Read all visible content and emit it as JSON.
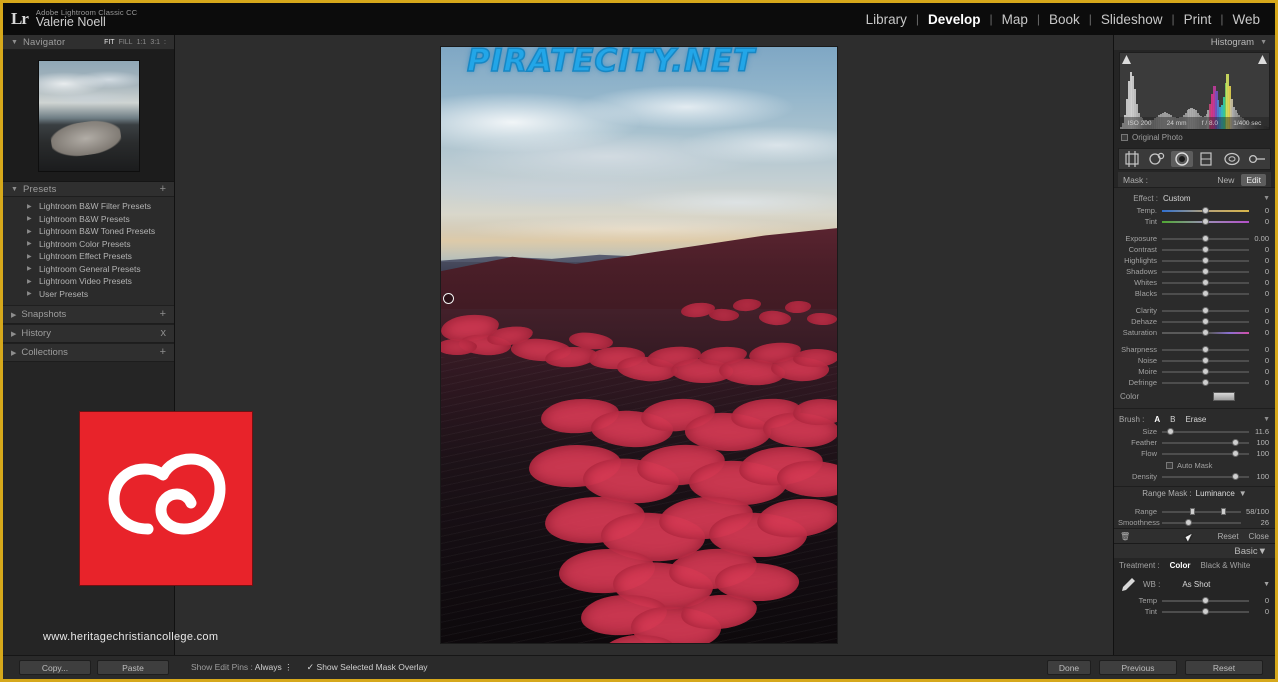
{
  "app": {
    "logo_text": "Lr",
    "product": "Adobe Lightroom Classic CC",
    "user": "Valerie Noell"
  },
  "modules": [
    {
      "label": "Library",
      "active": false
    },
    {
      "label": "Develop",
      "active": true
    },
    {
      "label": "Map",
      "active": false
    },
    {
      "label": "Book",
      "active": false
    },
    {
      "label": "Slideshow",
      "active": false
    },
    {
      "label": "Print",
      "active": false
    },
    {
      "label": "Web",
      "active": false
    }
  ],
  "left_panel": {
    "navigator": {
      "title": "Navigator",
      "zoom_levels": [
        "FIT",
        "FILL",
        "1:1",
        "3:1",
        ":"
      ],
      "selected_zoom": "FIT"
    },
    "presets": {
      "title": "Presets",
      "add_label": "+",
      "items": [
        "Lightroom B&W Filter Presets",
        "Lightroom B&W Presets",
        "Lightroom B&W Toned Presets",
        "Lightroom Color Presets",
        "Lightroom Effect Presets",
        "Lightroom General Presets",
        "Lightroom Video Presets",
        "User Presets"
      ]
    },
    "snapshots": {
      "title": "Snapshots",
      "action": "+"
    },
    "history": {
      "title": "History",
      "action": "x"
    },
    "collections": {
      "title": "Collections",
      "action": "+"
    }
  },
  "overlay": {
    "watermark": "PIRATECITY.NET",
    "site_url": "www.heritagechristiancollege.com",
    "cc_logo_color": "#e8232a"
  },
  "right_panel": {
    "histogram": {
      "title": "Histogram",
      "iso": "ISO 200",
      "focal_length": "24 mm",
      "aperture": "f / 8.0",
      "shutter": "1/400 sec",
      "original_photo_label": "Original Photo"
    },
    "tools": [
      {
        "name": "crop-overlay",
        "selected": false
      },
      {
        "name": "spot-removal",
        "selected": false
      },
      {
        "name": "redeye-correction",
        "selected": true
      },
      {
        "name": "graduated-filter",
        "selected": false
      },
      {
        "name": "radial-filter",
        "selected": false
      },
      {
        "name": "adjustment-brush",
        "selected": false
      }
    ],
    "mask": {
      "label": "Mask :",
      "new_label": "New",
      "edit_label": "Edit",
      "active": "Edit"
    },
    "effect": {
      "label": "Effect :",
      "value": "Custom"
    },
    "wb_sliders": [
      {
        "name": "Temp.",
        "value": "0",
        "pos": 50,
        "grad": "temp"
      },
      {
        "name": "Tint",
        "value": "0",
        "pos": 50,
        "grad": "tint"
      }
    ],
    "tone_sliders": [
      {
        "name": "Exposure",
        "value": "0.00",
        "pos": 50
      },
      {
        "name": "Contrast",
        "value": "0",
        "pos": 50
      },
      {
        "name": "Highlights",
        "value": "0",
        "pos": 50
      },
      {
        "name": "Shadows",
        "value": "0",
        "pos": 50
      },
      {
        "name": "Whites",
        "value": "0",
        "pos": 50
      },
      {
        "name": "Blacks",
        "value": "0",
        "pos": 50
      }
    ],
    "presence_sliders": [
      {
        "name": "Clarity",
        "value": "0",
        "pos": 50
      },
      {
        "name": "Dehaze",
        "value": "0",
        "pos": 50
      },
      {
        "name": "Saturation",
        "value": "0",
        "pos": 50,
        "grad": "sat"
      }
    ],
    "detail_sliders": [
      {
        "name": "Sharpness",
        "value": "0",
        "pos": 50
      },
      {
        "name": "Noise",
        "value": "0",
        "pos": 50
      },
      {
        "name": "Moire",
        "value": "0",
        "pos": 50
      },
      {
        "name": "Defringe",
        "value": "0",
        "pos": 50
      }
    ],
    "color_row": {
      "label": "Color"
    },
    "brush": {
      "label": "Brush :",
      "a_label": "A",
      "b_label": "B",
      "erase_label": "Erase",
      "active": "A",
      "sliders": [
        {
          "name": "Size",
          "value": "11.6",
          "pos": 10
        },
        {
          "name": "Feather",
          "value": "100",
          "pos": 84
        },
        {
          "name": "Flow",
          "value": "100",
          "pos": 84
        }
      ],
      "auto_mask_label": "Auto Mask",
      "auto_mask_checked": false,
      "density": {
        "name": "Density",
        "value": "100",
        "pos": 84
      }
    },
    "range_mask": {
      "label": "Range Mask :",
      "value": "Luminance",
      "range": {
        "name": "Range",
        "value": "58/100",
        "min_pos": 38,
        "max_pos": 78
      },
      "smoothness": {
        "name": "Smoothness",
        "value": "26",
        "pos": 34
      },
      "reset_label": "Reset",
      "close_label": "Close"
    },
    "basic": {
      "title": "Basic",
      "treatment_label": "Treatment :",
      "color_label": "Color",
      "bw_label": "Black & White",
      "active_treatment": "Color",
      "wb_label": "WB :",
      "wb_value": "As Shot",
      "temp": {
        "name": "Temp",
        "value": "0",
        "pos": 50
      },
      "tint": {
        "name": "Tint",
        "value": "0",
        "pos": 50
      }
    }
  },
  "bottom_bar": {
    "copy_label": "Copy...",
    "paste_label": "Paste",
    "show_edit_pins_label": "Show Edit Pins :",
    "show_edit_pins_value": "Always",
    "show_mask_overlay_label": "Show Selected Mask Overlay",
    "show_mask_overlay_checked": true,
    "done_label": "Done",
    "previous_label": "Previous",
    "reset_label": "Reset"
  }
}
